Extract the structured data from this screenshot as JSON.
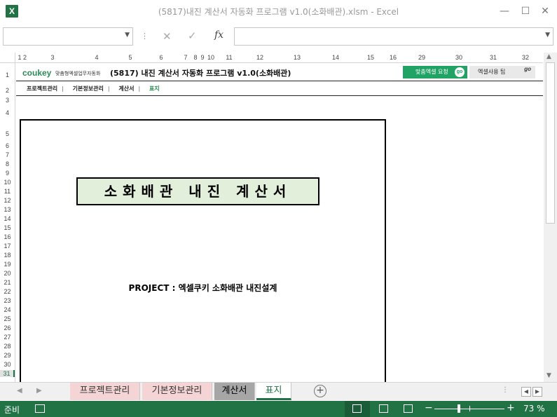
{
  "window": {
    "title": "(5817)내진 계산서 자동화 프로그램 v1.0(소화배관).xlsm - Excel",
    "app_icon": "excel-icon",
    "controls": [
      "minimize-icon",
      "restore-icon",
      "close-icon"
    ]
  },
  "formula_bar": {
    "name_box": "",
    "formula": "",
    "fx_label": "fx",
    "cancel_icon": "✕",
    "enter_icon": "✓"
  },
  "columns": [
    "1",
    "2",
    "3",
    "4",
    "5",
    "6",
    "7",
    "8",
    "9",
    "10",
    "11",
    "12",
    "13",
    "14",
    "15",
    "16",
    "29",
    "30",
    "31",
    "32"
  ],
  "rows": [
    "1",
    "2",
    "3",
    "4",
    "5",
    "6",
    "7",
    "8",
    "9",
    "10",
    "11",
    "12",
    "13",
    "14",
    "15",
    "16",
    "17",
    "18",
    "19",
    "20",
    "21",
    "22",
    "23",
    "24",
    "25",
    "26",
    "27",
    "28",
    "29",
    "30",
    "31"
  ],
  "selected_row": "31",
  "sheet": {
    "logo_text": "coukey",
    "logo_sub": "맞춤형엑셀업무자동화",
    "title": "(5817) 내진 계산서 자동화 프로그램 v1.0(소화배관)",
    "custom_request_label": "맞춤엑셀 요청",
    "custom_request_go": "go",
    "tips_label": "엑셀사용 팁",
    "tips_go": "go",
    "nav": [
      "프로젝트관리",
      "기본정보관리",
      "계산서",
      "표지"
    ],
    "nav_separator": "|",
    "cover_title": "소화배관 내진 계산서",
    "project_line": "PROJECT : 엑셀쿠키 소화배관 내진설계"
  },
  "tabs": [
    {
      "label": "프로젝트관리",
      "color": "#f4d4d4"
    },
    {
      "label": "기본정보관리",
      "color": "#f4d4d4"
    },
    {
      "label": "계산서",
      "color": "#a6a6a6"
    },
    {
      "label": "표지",
      "color": "#ffffff",
      "active": true
    }
  ],
  "status": {
    "ready": "준비",
    "zoom": "73 %",
    "zoom_minus": "−",
    "zoom_plus": "+"
  },
  "colors": {
    "excel_green": "#217346",
    "header_green": "#e2efda",
    "go_button_green": "#21a366"
  }
}
